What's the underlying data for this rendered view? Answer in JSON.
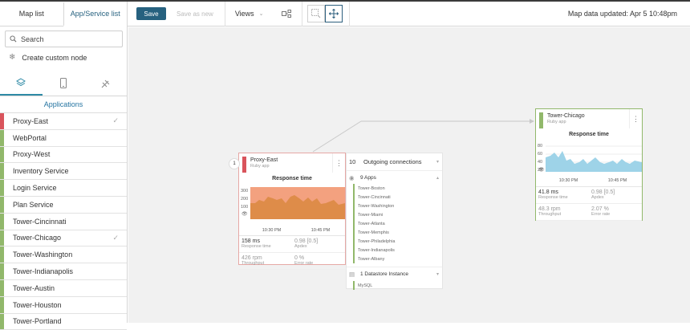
{
  "left_tabs": [
    "Map list",
    "App/Service list"
  ],
  "search_label": "Search",
  "custom_node_label": "Create custom node",
  "applications_title": "Applications",
  "apps": [
    {
      "name": "Proxy-East",
      "color": "#d9545c",
      "checked": true
    },
    {
      "name": "WebPortal",
      "color": "#91b86b",
      "checked": false
    },
    {
      "name": "Proxy-West",
      "color": "#91b86b",
      "checked": false
    },
    {
      "name": "Inventory Service",
      "color": "#91b86b",
      "checked": false
    },
    {
      "name": "Login Service",
      "color": "#91b86b",
      "checked": false
    },
    {
      "name": "Plan Service",
      "color": "#91b86b",
      "checked": false
    },
    {
      "name": "Tower-Cincinnati",
      "color": "#91b86b",
      "checked": false
    },
    {
      "name": "Tower-Chicago",
      "color": "#91b86b",
      "checked": true
    },
    {
      "name": "Tower-Washington",
      "color": "#91b86b",
      "checked": false
    },
    {
      "name": "Tower-Indianapolis",
      "color": "#91b86b",
      "checked": false
    },
    {
      "name": "Tower-Austin",
      "color": "#91b86b",
      "checked": false
    },
    {
      "name": "Tower-Houston",
      "color": "#91b86b",
      "checked": false
    },
    {
      "name": "Tower-Portland",
      "color": "#91b86b",
      "checked": false
    }
  ],
  "toolbar": {
    "save_label": "Save",
    "save_as_label": "Save as new",
    "views_label": "Views",
    "updated_label": "Map data updated: Apr 5 10:48pm"
  },
  "proxy_east": {
    "index": "1",
    "name": "Proxy-East",
    "type": "Ruby app",
    "chart_title": "Response time",
    "y_ticks": [
      "300",
      "200",
      "100"
    ],
    "x_ticks": [
      "10:30 PM",
      "10:45 PM"
    ],
    "response_time": "158 ms",
    "response_time_label": "Response time",
    "apdex": "0.98 [0.5]",
    "apdex_label": "Apdex",
    "throughput": "426 rpm",
    "throughput_label": "Throughput",
    "error_rate": "0 %",
    "error_rate_label": "Error rate",
    "color": "#d9545c"
  },
  "connections": {
    "outgoing_count": "10",
    "outgoing_label": "Outgoing connections",
    "apps_label": "9 Apps",
    "apps": [
      "Tower-Boston",
      "Tower-Cincinnati",
      "Tower-Washington",
      "Tower-Miami",
      "Tower-Atlanta",
      "Tower-Memphis",
      "Tower-Philadelphia",
      "Tower-Indianapolis",
      "Tower-Albany"
    ],
    "datastore_label": "1 Datastore Instance",
    "datastore_item": "MySQL"
  },
  "tower_chicago": {
    "name": "Tower-Chicago",
    "type": "Ruby app",
    "chart_title": "Response time",
    "y_ticks": [
      "80",
      "60",
      "40",
      "20"
    ],
    "x_ticks": [
      "10:30 PM",
      "10:45 PM"
    ],
    "response_time": "41.8 ms",
    "response_time_label": "Response time",
    "apdex": "0.98 [0.5]",
    "apdex_label": "Apdex",
    "throughput": "48.3 rpm",
    "throughput_label": "Throughput",
    "error_rate": "2.07 %",
    "error_rate_label": "Error rate",
    "color": "#91b86b"
  }
}
